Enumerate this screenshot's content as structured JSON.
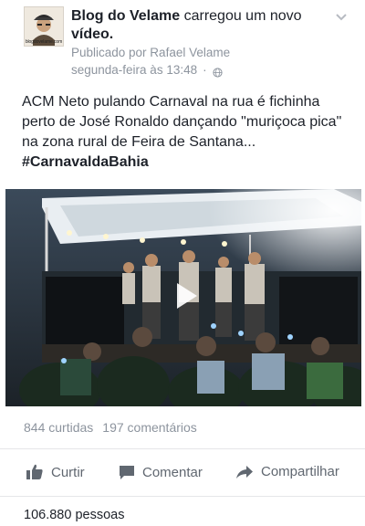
{
  "post": {
    "page_name": "Blog do Velame",
    "action_text": " carregou um novo ",
    "action_object": "vídeo.",
    "published_by": "Publicado por Rafael Velame",
    "timestamp": "segunda-feira às 13:48",
    "separator": "·",
    "avatar_caption": "blogdovelame.com",
    "text": "ACM Neto pulando Carnaval na rua é fichinha perto de José Ronaldo dançando \"muriçoca pica\" na zona rural de Feira de Santana... ",
    "hashtag": "#CarnavaldaBahia"
  },
  "stats": {
    "likes": "844 curtidas",
    "comments": "197 comentários"
  },
  "actions": {
    "like_label": "Curtir",
    "comment_label": "Comentar",
    "share_label": "Compartilhar"
  },
  "reach": "106.880 pessoas",
  "icons": {
    "chevron": "chevron-down-icon",
    "globe": "globe-icon",
    "play": "play-icon",
    "like": "thumbs-up-icon",
    "comment": "comment-icon",
    "share": "share-arrow-icon"
  },
  "colors": {
    "text": "#1d2129",
    "muted": "#8d949e",
    "action": "#606770"
  }
}
